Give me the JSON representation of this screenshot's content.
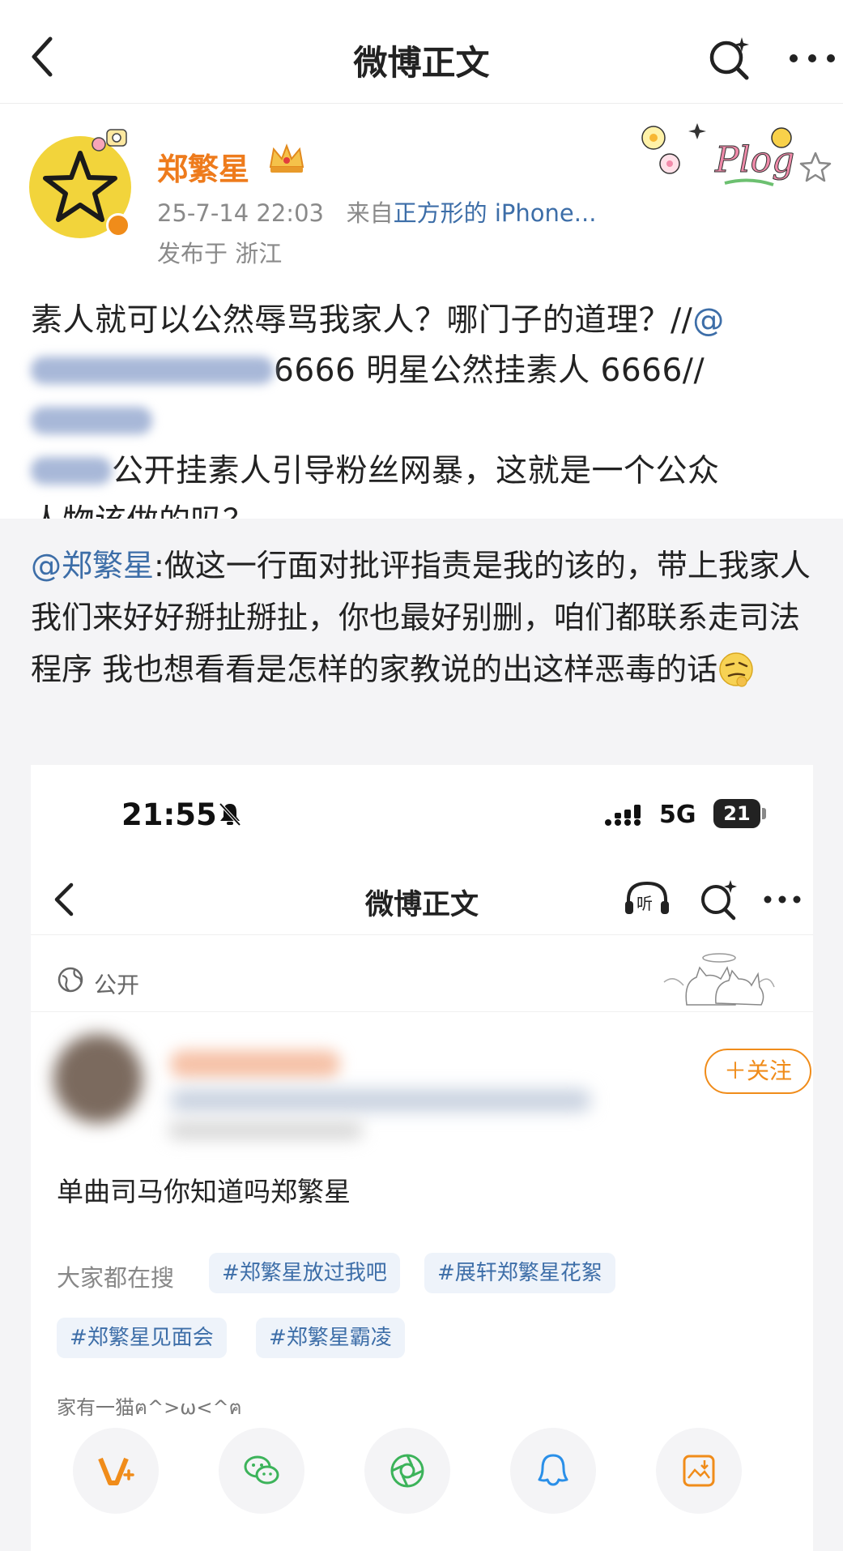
{
  "nav": {
    "title": "微博正文",
    "back_icon": "chevron-left-icon",
    "search_icon": "search-sparkle-icon",
    "more_icon": "more-dots-icon"
  },
  "author": {
    "name": "郑繁星",
    "time": "25-7-14 22:03",
    "from_label": "来自",
    "source": "正方形的 iPhone...",
    "location": "发布于  浙江",
    "badge_text": "Plog"
  },
  "post": {
    "line1": "素人就可以公然辱骂我家人？哪门子的道理？//",
    "line1_at": "@",
    "line2": "6666 明星公然挂素人 6666//",
    "line3": "公开挂素人引导粉丝网暴，这就是一个公众",
    "line4": "人物该做的吗？"
  },
  "quote": {
    "at": "@郑繁星",
    "text": ":做这一行面对批评指责是我的该的，带上我家人我们来好好掰扯掰扯，你也最好别删，咱们都联系走司法程序 我也想看看是怎样的家教说的出这样恶毒的话"
  },
  "screenshot": {
    "status_time": "21:55",
    "network": "5G",
    "battery": "21",
    "nav_title": "微博正文",
    "visibility": "公开",
    "follow_label": "＋关注",
    "post_text": "单曲司马你知道吗郑繁星",
    "hot_search_label": "大家都在搜",
    "tags": [
      "#郑繁星放过我吧",
      "#展轩郑繁星花絮",
      "#郑繁星见面会",
      "#郑繁星霸凌"
    ],
    "source_text": "家有一猫ฅ^>ω<^ฅ",
    "share_icons": [
      "vplus-icon",
      "wechat-icon",
      "moments-icon",
      "qq-icon",
      "save-image-icon"
    ]
  },
  "colors": {
    "brand_orange": "#ee7b1c",
    "link_blue": "#3d6ea8",
    "quote_bg": "#f4f4f6",
    "tag_bg": "#eef3fa"
  }
}
